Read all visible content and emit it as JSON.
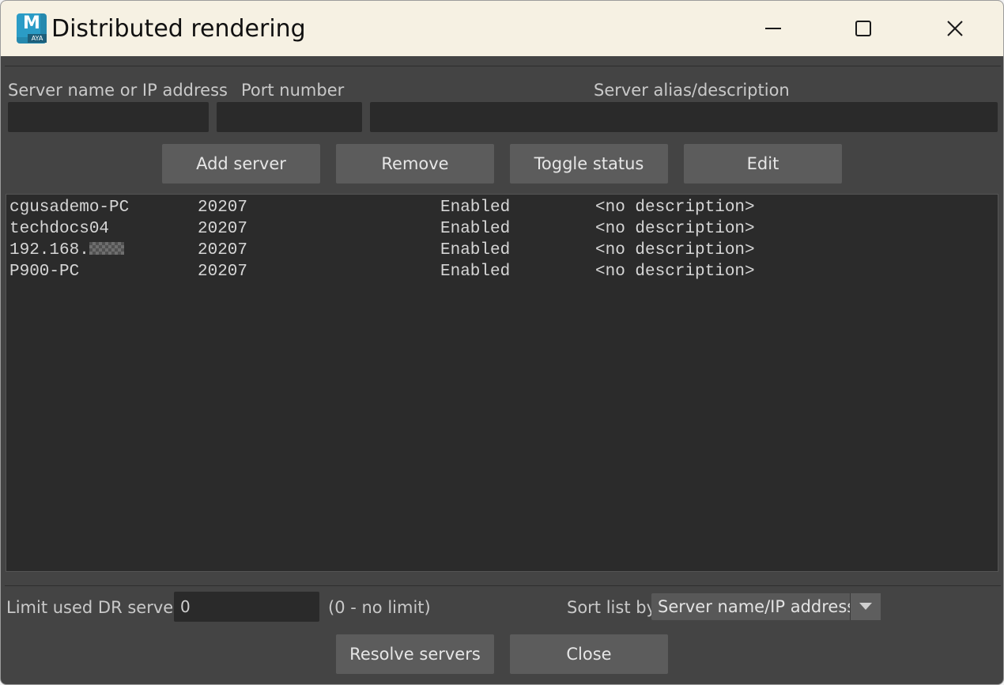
{
  "window": {
    "title": "Distributed rendering",
    "icon_letter": "M",
    "icon_sub": "AYA"
  },
  "inputs": {
    "server_label": "Server name or IP address",
    "server_value": "",
    "port_label": "Port number",
    "port_value": "",
    "alias_label": "Server alias/description",
    "alias_value": ""
  },
  "buttons": {
    "add": "Add server",
    "remove": "Remove",
    "toggle": "Toggle status",
    "edit": "Edit",
    "resolve": "Resolve servers",
    "close": "Close"
  },
  "servers": [
    {
      "name": "cgusademo-PC",
      "port": "20207",
      "status": "Enabled",
      "description": "<no description>"
    },
    {
      "name": "techdocs04",
      "port": "20207",
      "status": "Enabled",
      "description": "<no description>"
    },
    {
      "name": "192.168.",
      "port": "20207",
      "status": "Enabled",
      "description": "<no description>"
    },
    {
      "name": "P900-PC",
      "port": "20207",
      "status": "Enabled",
      "description": "<no description>"
    }
  ],
  "footer": {
    "limit_label": "Limit used DR servers",
    "limit_value": "0",
    "limit_hint": "(0 - no limit)",
    "sort_label": "Sort list by",
    "sort_value": "Server name/IP address"
  },
  "icons": {
    "app": "maya-app-icon",
    "minimize": "minimize-icon",
    "maximize": "maximize-icon",
    "close": "close-icon",
    "dropdown": "chevron-down-icon"
  }
}
